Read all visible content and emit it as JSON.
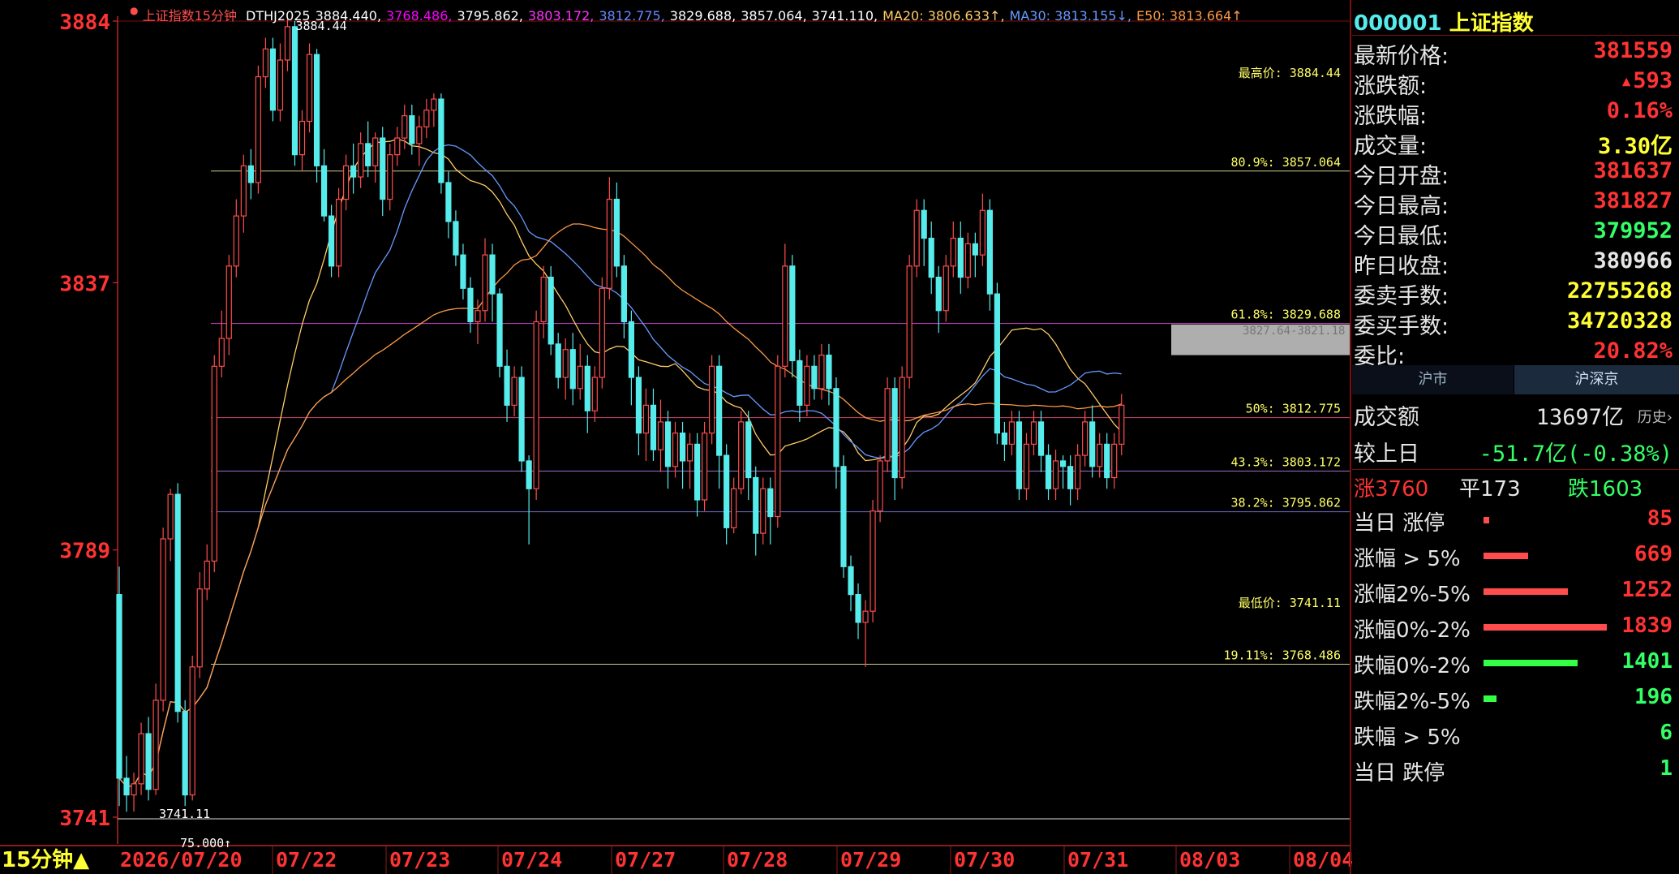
{
  "colors": {
    "up": "#ff4d4d",
    "down": "#56ecec",
    "text_red": "#ff3333",
    "green": "#33ff66",
    "yellow": "#ffff33"
  },
  "legend": {
    "name": "上证指数15分钟",
    "items": [
      {
        "text": "DTHJ2025",
        "color": "#ffffff"
      },
      {
        "text": "3884.440,",
        "color": "#ffffff"
      },
      {
        "text": "3768.486,",
        "color": "#ff00ff"
      },
      {
        "text": "3795.862,",
        "color": "#ffffff"
      },
      {
        "text": "3803.172,",
        "color": "#ff33ff"
      },
      {
        "text": "3812.775,",
        "color": "#6688ff"
      },
      {
        "text": "3829.688,",
        "color": "#ffffff"
      },
      {
        "text": "3857.064,",
        "color": "#ffffff"
      },
      {
        "text": "3741.110,",
        "color": "#ffffff"
      },
      {
        "text": "MA20: 3806.633↑,",
        "color": "#ffcc66"
      },
      {
        "text": "MA30: 3813.155↓,",
        "color": "#6699ff"
      },
      {
        "text": "E50: 3813.664↑",
        "color": "#ff9944"
      }
    ]
  },
  "chart_data": {
    "type": "candlestick",
    "ylim": [
      3741,
      3884
    ],
    "y_ticks": [
      "3884",
      "3837",
      "3789",
      "3741"
    ],
    "x_labels": [
      "2026/07/20",
      "07/22",
      "07/23",
      "07/24",
      "07/27",
      "07/28",
      "07/29",
      "07/30",
      "07/31",
      "08/03",
      "08/04"
    ],
    "period_label": "15分钟▲",
    "bottom_value": "75.000↑",
    "high_marker": "3884.44",
    "low_marker": "3741.11",
    "fib_levels": [
      {
        "label": "最高价: 3884.44",
        "value": 3884.44,
        "color": "#ffffff"
      },
      {
        "label": "80.9%: 3857.064",
        "value": 3857.064,
        "color": "#ffffaa"
      },
      {
        "label": "61.8%: 3829.688",
        "value": 3829.688,
        "color": "#ff55ff"
      },
      {
        "label": "50%: 3812.775",
        "value": 3812.775,
        "color": "#ff5588"
      },
      {
        "label": "43.3%: 3803.172",
        "value": 3803.172,
        "color": "#cc88ff"
      },
      {
        "label": "38.2%: 3795.862",
        "value": 3795.862,
        "color": "#8888ff"
      },
      {
        "label": "最低价: 3741.11",
        "value": 3741.11,
        "color": "#ffffff"
      },
      {
        "label": "19.11%: 3768.486",
        "value": 3768.486,
        "color": "#ffffaa"
      }
    ],
    "box_label": "3827.64-3821.18",
    "candles": [
      [
        3781,
        3748,
        3786,
        3743
      ],
      [
        3748,
        3745,
        3752,
        3742
      ],
      [
        3745,
        3747,
        3749,
        3742
      ],
      [
        3747,
        3756,
        3758,
        3745
      ],
      [
        3756,
        3746,
        3759,
        3744
      ],
      [
        3746,
        3762,
        3765,
        3745
      ],
      [
        3762,
        3791,
        3793,
        3760
      ],
      [
        3791,
        3799,
        3800,
        3787
      ],
      [
        3799,
        3760,
        3801,
        3758
      ],
      [
        3760,
        3745,
        3762,
        3743
      ],
      [
        3745,
        3768,
        3770,
        3744
      ],
      [
        3768,
        3782,
        3785,
        3766
      ],
      [
        3782,
        3787,
        3790,
        3780
      ],
      [
        3787,
        3822,
        3824,
        3785
      ],
      [
        3822,
        3827,
        3832,
        3820
      ],
      [
        3827,
        3840,
        3842,
        3824
      ],
      [
        3840,
        3849,
        3852,
        3838
      ],
      [
        3849,
        3858,
        3860,
        3846
      ],
      [
        3858,
        3855,
        3861,
        3852
      ],
      [
        3855,
        3874,
        3876,
        3853
      ],
      [
        3874,
        3879,
        3881,
        3872
      ],
      [
        3879,
        3868,
        3881,
        3866
      ],
      [
        3868,
        3877,
        3880,
        3866
      ],
      [
        3877,
        3883,
        3884.4,
        3875
      ],
      [
        3883,
        3860,
        3884,
        3858
      ],
      [
        3860,
        3866,
        3868,
        3857
      ],
      [
        3866,
        3878,
        3880,
        3864
      ],
      [
        3878,
        3858,
        3879,
        3855
      ],
      [
        3858,
        3849,
        3861,
        3848
      ],
      [
        3849,
        3840,
        3851,
        3838
      ],
      [
        3840,
        3852,
        3854,
        3838
      ],
      [
        3852,
        3858,
        3860,
        3850
      ],
      [
        3858,
        3856,
        3862,
        3853
      ],
      [
        3856,
        3862,
        3864,
        3854
      ],
      [
        3862,
        3858,
        3866,
        3856
      ],
      [
        3858,
        3863,
        3864,
        3855
      ],
      [
        3863,
        3852,
        3865,
        3849
      ],
      [
        3852,
        3860,
        3862,
        3850
      ],
      [
        3860,
        3863,
        3865,
        3858
      ],
      [
        3863,
        3867,
        3869,
        3861
      ],
      [
        3867,
        3862,
        3869,
        3860
      ],
      [
        3862,
        3865,
        3867,
        3858
      ],
      [
        3865,
        3868,
        3870,
        3863
      ],
      [
        3868,
        3870,
        3871,
        3865
      ],
      [
        3870,
        3855,
        3871,
        3853
      ],
      [
        3855,
        3848,
        3857,
        3845
      ],
      [
        3848,
        3842,
        3850,
        3840
      ],
      [
        3842,
        3836,
        3844,
        3834
      ],
      [
        3836,
        3830,
        3838,
        3828
      ],
      [
        3830,
        3832,
        3834,
        3826
      ],
      [
        3832,
        3842,
        3845,
        3830
      ],
      [
        3842,
        3835,
        3844,
        3830
      ],
      [
        3835,
        3822,
        3836,
        3820
      ],
      [
        3822,
        3815,
        3825,
        3812
      ],
      [
        3815,
        3820,
        3822,
        3813
      ],
      [
        3820,
        3805,
        3822,
        3803
      ],
      [
        3805,
        3800,
        3806,
        3790
      ],
      [
        3800,
        3830,
        3832,
        3798
      ],
      [
        3830,
        3838,
        3840,
        3827
      ],
      [
        3838,
        3826,
        3840,
        3824
      ],
      [
        3826,
        3820,
        3828,
        3818
      ],
      [
        3820,
        3825,
        3827,
        3816
      ],
      [
        3825,
        3818,
        3828,
        3815
      ],
      [
        3818,
        3822,
        3826,
        3816
      ],
      [
        3822,
        3814,
        3824,
        3810
      ],
      [
        3814,
        3820,
        3822,
        3812
      ],
      [
        3820,
        3836,
        3838,
        3818
      ],
      [
        3836,
        3852,
        3856,
        3834
      ],
      [
        3852,
        3840,
        3855,
        3838
      ],
      [
        3840,
        3830,
        3842,
        3827
      ],
      [
        3830,
        3820,
        3832,
        3815
      ],
      [
        3820,
        3810,
        3822,
        3806
      ],
      [
        3810,
        3815,
        3818,
        3805
      ],
      [
        3815,
        3807,
        3818,
        3805
      ],
      [
        3807,
        3812,
        3816,
        3803
      ],
      [
        3812,
        3804,
        3814,
        3800
      ],
      [
        3804,
        3810,
        3812,
        3802
      ],
      [
        3810,
        3805,
        3812,
        3800
      ],
      [
        3805,
        3808,
        3810,
        3800
      ],
      [
        3808,
        3798,
        3810,
        3795
      ],
      [
        3798,
        3810,
        3812,
        3796
      ],
      [
        3810,
        3822,
        3824,
        3808
      ],
      [
        3822,
        3806,
        3824,
        3800
      ],
      [
        3806,
        3793,
        3808,
        3790
      ],
      [
        3793,
        3800,
        3802,
        3792
      ],
      [
        3800,
        3812,
        3814,
        3799
      ],
      [
        3812,
        3802,
        3814,
        3798
      ],
      [
        3802,
        3792,
        3804,
        3788
      ],
      [
        3792,
        3800,
        3802,
        3790
      ],
      [
        3800,
        3795,
        3802,
        3790
      ],
      [
        3795,
        3822,
        3824,
        3793
      ],
      [
        3822,
        3840,
        3844,
        3820
      ],
      [
        3840,
        3823,
        3842,
        3820
      ],
      [
        3823,
        3815,
        3825,
        3812
      ],
      [
        3815,
        3822,
        3824,
        3813
      ],
      [
        3822,
        3818,
        3824,
        3816
      ],
      [
        3818,
        3824,
        3826,
        3816
      ],
      [
        3824,
        3818,
        3826,
        3815
      ],
      [
        3818,
        3804,
        3820,
        3800
      ],
      [
        3804,
        3786,
        3806,
        3784
      ],
      [
        3786,
        3781,
        3788,
        3778
      ],
      [
        3781,
        3776,
        3783,
        3773
      ],
      [
        3776,
        3778,
        3780,
        3768
      ],
      [
        3778,
        3796,
        3798,
        3776
      ],
      [
        3796,
        3805,
        3806,
        3794
      ],
      [
        3805,
        3818,
        3820,
        3803
      ],
      [
        3818,
        3802,
        3820,
        3798
      ],
      [
        3802,
        3820,
        3822,
        3800
      ],
      [
        3820,
        3840,
        3842,
        3818
      ],
      [
        3840,
        3850,
        3852,
        3838
      ],
      [
        3850,
        3845,
        3852,
        3840
      ],
      [
        3845,
        3838,
        3848,
        3835
      ],
      [
        3838,
        3832,
        3840,
        3828
      ],
      [
        3832,
        3840,
        3842,
        3830
      ],
      [
        3840,
        3845,
        3848,
        3838
      ],
      [
        3845,
        3838,
        3848,
        3835
      ],
      [
        3838,
        3844,
        3846,
        3836
      ],
      [
        3844,
        3842,
        3846,
        3838
      ],
      [
        3842,
        3850,
        3853,
        3840
      ],
      [
        3850,
        3835,
        3852,
        3832
      ],
      [
        3835,
        3810,
        3837,
        3808
      ],
      [
        3810,
        3808,
        3812,
        3805
      ],
      [
        3808,
        3812,
        3814,
        3806
      ],
      [
        3812,
        3800,
        3814,
        3798
      ],
      [
        3800,
        3808,
        3810,
        3798
      ],
      [
        3808,
        3812,
        3814,
        3806
      ],
      [
        3812,
        3806,
        3814,
        3803
      ],
      [
        3806,
        3800,
        3808,
        3798
      ],
      [
        3800,
        3805,
        3807,
        3798
      ],
      [
        3805,
        3804,
        3806,
        3800
      ],
      [
        3804,
        3800,
        3806,
        3797
      ],
      [
        3800,
        3806,
        3808,
        3798
      ],
      [
        3806,
        3812,
        3814,
        3804
      ],
      [
        3812,
        3804,
        3815,
        3802
      ],
      [
        3804,
        3808,
        3810,
        3802
      ],
      [
        3808,
        3802,
        3810,
        3800
      ],
      [
        3802,
        3808,
        3810,
        3800
      ],
      [
        3808,
        3815,
        3817,
        3806
      ]
    ]
  },
  "panel": {
    "code": "000001",
    "name": "上证指数",
    "quote_rows": [
      {
        "label": "最新价格:",
        "value": "381559",
        "color": "#ff3333"
      },
      {
        "label": "涨跌额:",
        "value": "▴593",
        "color": "#ff3333"
      },
      {
        "label": "涨跌幅:",
        "value": "0.16%",
        "color": "#ff3333"
      },
      {
        "label": "成交量:",
        "value": "3.30亿",
        "color": "#ffff33"
      },
      {
        "label": "今日开盘:",
        "value": "381637",
        "color": "#ff3333"
      },
      {
        "label": "今日最高:",
        "value": "381827",
        "color": "#ff3333"
      },
      {
        "label": "今日最低:",
        "value": "379952",
        "color": "#33ff66"
      },
      {
        "label": "昨日收盘:",
        "value": "380966",
        "color": "#e6e6e6"
      },
      {
        "label": "委卖手数:",
        "value": "22755268",
        "color": "#ffff33"
      },
      {
        "label": "委买手数:",
        "value": "34720328",
        "color": "#ffff33"
      },
      {
        "label": "委比:",
        "value": "20.82%",
        "color": "#ff3333"
      }
    ],
    "tabs": [
      "沪市",
      "沪深京"
    ],
    "turnover_label": "成交额",
    "turnover_value": "13697亿",
    "history_label": "历史›",
    "compare_label": "较上日",
    "compare_value": "-51.7亿(-0.38%)",
    "breadth": {
      "up": "涨3760",
      "flat": "平173",
      "down": "跌1603"
    },
    "breakdown": [
      {
        "label": "当日 涨停",
        "count": "85",
        "frac": 0.046,
        "color": "#ff4d4d"
      },
      {
        "label": "涨幅 > 5%",
        "count": "669",
        "frac": 0.364,
        "color": "#ff4d4d"
      },
      {
        "label": "涨幅2%-5%",
        "count": "1252",
        "frac": 0.681,
        "color": "#ff4d4d"
      },
      {
        "label": "涨幅0%-2%",
        "count": "1839",
        "frac": 1.0,
        "color": "#ff4d4d"
      },
      {
        "label": "跌幅0%-2%",
        "count": "1401",
        "frac": 0.762,
        "color": "#33ff44"
      },
      {
        "label": "跌幅2%-5%",
        "count": "196",
        "frac": 0.107,
        "color": "#33ff44"
      },
      {
        "label": "跌幅 > 5%",
        "count": "6",
        "frac": 0.0,
        "color": "#33ff44"
      },
      {
        "label": "当日 跌停",
        "count": "1",
        "frac": 0.0,
        "color": "#33ff44"
      }
    ]
  }
}
